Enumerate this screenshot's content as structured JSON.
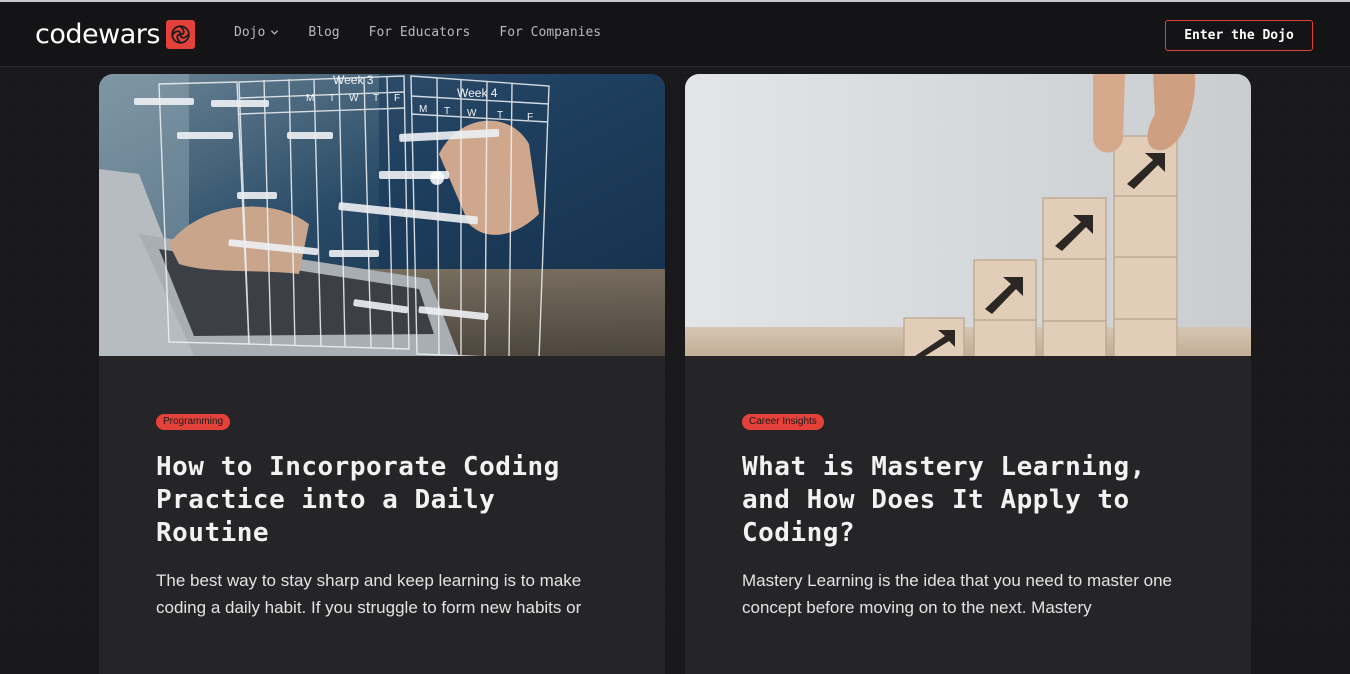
{
  "brand": {
    "name": "codewars",
    "accent": "#e5413b"
  },
  "nav": {
    "links": [
      "Dojo",
      "Blog",
      "For Educators",
      "For Companies"
    ],
    "cta": "Enter the Dojo"
  },
  "cards": [
    {
      "image": "calendar-planner-laptop-photo",
      "image_labels": [
        "Week 3",
        "Week 4"
      ],
      "weekday_letters": [
        "M",
        "T",
        "W",
        "T",
        "F"
      ],
      "tag": "Programming",
      "title": "How to Incorporate Coding Practice into a Daily Routine",
      "excerpt": "The best way to stay sharp and keep learning is to make coding a daily habit. If you struggle to form new habits or"
    },
    {
      "image": "wooden-blocks-growth-arrows-photo",
      "tag": "Career Insights",
      "title": "What is Mastery Learning, and How Does It Apply to Coding?",
      "excerpt": "Mastery Learning is the idea that you need to master one concept before moving on to the next. Mastery"
    }
  ]
}
